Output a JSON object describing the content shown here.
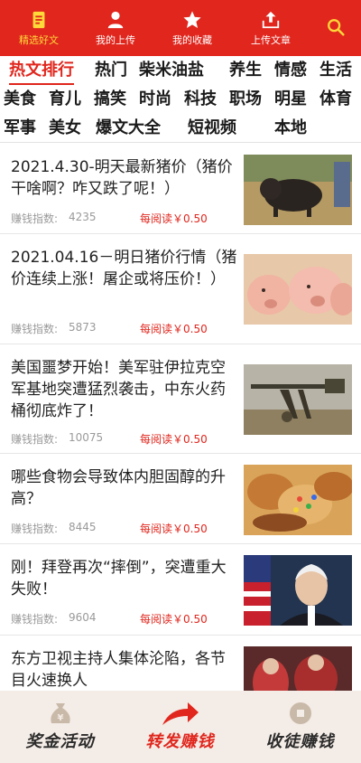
{
  "top_nav": {
    "items": [
      {
        "label": "精选好文",
        "icon": "document-icon",
        "active": true
      },
      {
        "label": "我的上传",
        "icon": "user-icon",
        "active": false
      },
      {
        "label": "我的收藏",
        "icon": "star-icon",
        "active": false
      },
      {
        "label": "上传文章",
        "icon": "upload-icon",
        "active": false
      }
    ],
    "search_icon": "search-icon"
  },
  "categories": [
    "热文排行",
    "热门",
    "柴米油盐",
    "养生",
    "情感",
    "生活",
    "美食",
    "育儿",
    "搞笑",
    "时尚",
    "科技",
    "职场",
    "明星",
    "体育",
    "军事",
    "美女",
    "爆文大全",
    "短视频",
    "本地"
  ],
  "active_category": "热文排行",
  "article_meta_label": "赚钱指数:",
  "article_reward_label": "每阅读￥0.50",
  "articles": [
    {
      "title": "2021.4.30-明天最新猪价（猪价干啥啊？咋又跌了呢！）",
      "index": "4235"
    },
    {
      "title": "2021.04.16－明日猪价行情（猪价连续上涨！屠企或将压价！）",
      "index": "5873"
    },
    {
      "title": "美国噩梦开始！美军驻伊拉克空军基地突遭猛烈袭击，中东火药桶彻底炸了！",
      "index": "10075"
    },
    {
      "title": "哪些食物会导致体内胆固醇的升高？",
      "index": "8445"
    },
    {
      "title": "刚！拜登再次“摔倒”，突遭重大失败！",
      "index": "9604"
    },
    {
      "title": "东方卫视主持人集体沦陷，各节目火速换人",
      "index": ""
    }
  ],
  "bottom_tabs": [
    {
      "label": "奖金活动",
      "icon": "money-bag-icon"
    },
    {
      "label": "转发赚钱",
      "icon": "share-arrow-icon"
    },
    {
      "label": "收徒赚钱",
      "icon": "coin-icon"
    }
  ],
  "colors": {
    "brand_red": "#e0261d",
    "active_yellow": "#ffd83a"
  }
}
